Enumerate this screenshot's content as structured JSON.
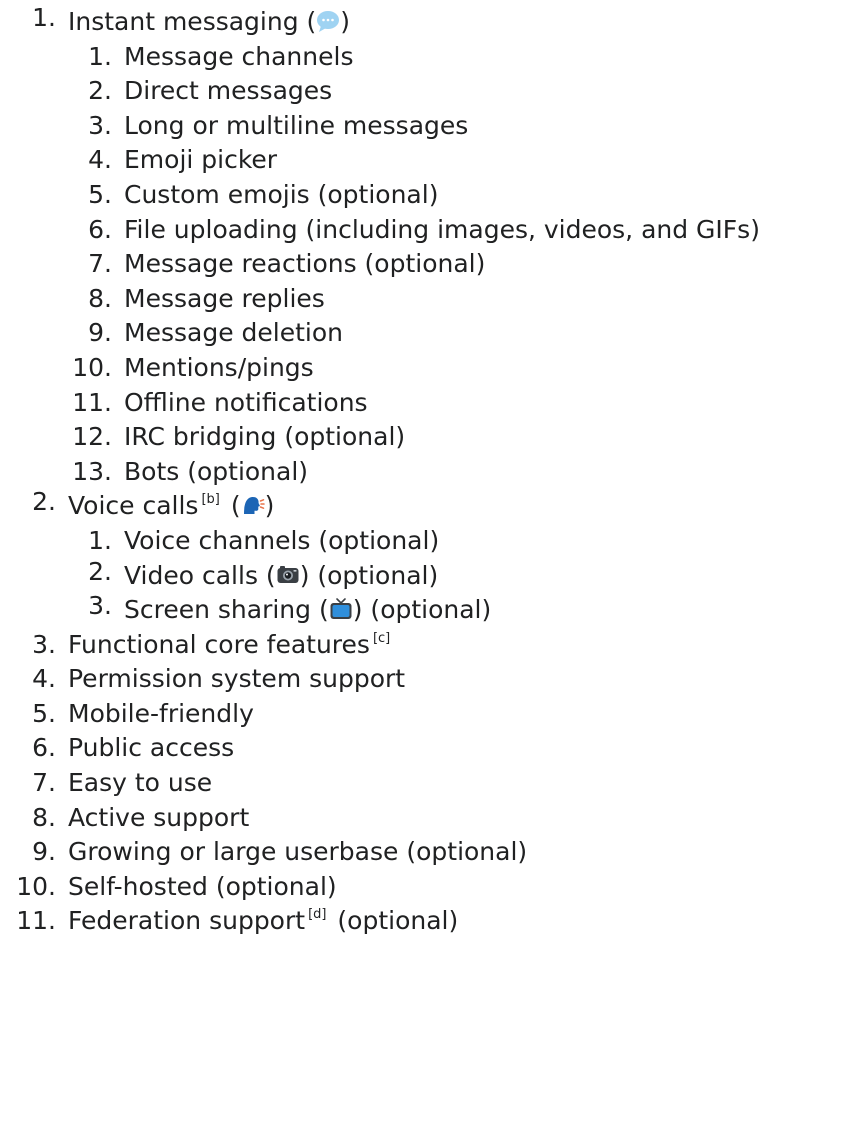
{
  "items": [
    {
      "num": "1.",
      "text": "Instant messaging (",
      "emoji": "speech-balloon-icon",
      "tail": ")"
    },
    {
      "num": "2.",
      "text": "Voice calls",
      "ref": "[b]",
      "text2": " (",
      "emoji": "speaking-head-icon",
      "tail": ")"
    },
    {
      "num": "3.",
      "text": "Functional core features",
      "ref": "[c]"
    },
    {
      "num": "4.",
      "text": "Permission system support"
    },
    {
      "num": "5.",
      "text": "Mobile-friendly"
    },
    {
      "num": "6.",
      "text": "Public access"
    },
    {
      "num": "7.",
      "text": "Easy to use"
    },
    {
      "num": "8.",
      "text": "Active support"
    },
    {
      "num": "9.",
      "text": "Growing or large userbase (optional)"
    },
    {
      "num": "10.",
      "text": "Self-hosted (optional)"
    },
    {
      "num": "11.",
      "text": "Federation support",
      "ref": "[d]",
      "tail": " (optional)"
    }
  ],
  "messaging_sub": [
    {
      "num": "1.",
      "text": "Message channels"
    },
    {
      "num": "2.",
      "text": "Direct messages"
    },
    {
      "num": "3.",
      "text": "Long or multiline messages"
    },
    {
      "num": "4.",
      "text": "Emoji picker"
    },
    {
      "num": "5.",
      "text": "Custom emojis (optional)"
    },
    {
      "num": "6.",
      "text": "File uploading (including images, videos, and GIFs)"
    },
    {
      "num": "7.",
      "text": "Message reactions (optional)"
    },
    {
      "num": "8.",
      "text": "Message replies"
    },
    {
      "num": "9.",
      "text": "Message deletion"
    },
    {
      "num": "10.",
      "text": "Mentions/pings"
    },
    {
      "num": "11.",
      "text": "Offline notifications"
    },
    {
      "num": "12.",
      "text": "IRC bridging (optional)"
    },
    {
      "num": "13.",
      "text": "Bots (optional)"
    }
  ],
  "voice_sub": [
    {
      "num": "1.",
      "text": "Voice channels (optional)"
    },
    {
      "num": "2.",
      "text": "Video calls (",
      "emoji": "camera-icon",
      "tail": ") (optional)"
    },
    {
      "num": "3.",
      "text": "Screen sharing (",
      "emoji": "television-icon",
      "tail": ") (optional)"
    }
  ],
  "colors": {
    "text": "#202122",
    "speech_balloon": "#9fd3f2",
    "speaking_head": "#1c65b5",
    "camera": "#3a3f44",
    "television": "#2f8fdc"
  }
}
